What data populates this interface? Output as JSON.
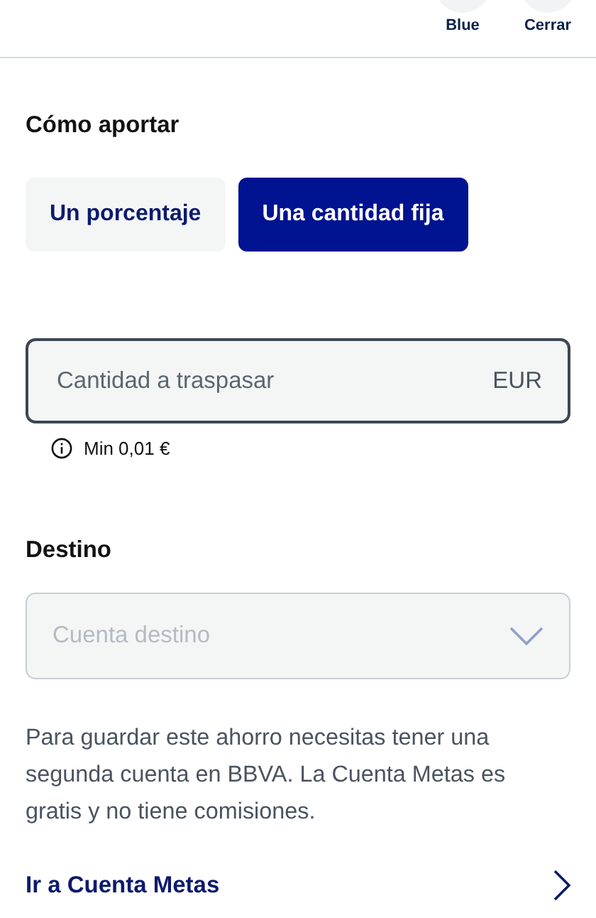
{
  "header_actions": [
    {
      "label": "Blue"
    },
    {
      "label": "Cerrar"
    }
  ],
  "section_title": "Cómo aportar",
  "options": [
    {
      "label": "Un porcentaje",
      "selected": false
    },
    {
      "label": "Una cantidad fija",
      "selected": true
    }
  ],
  "amount_field": {
    "placeholder": "Cantidad a traspasar",
    "currency": "EUR"
  },
  "hint": "Min 0,01 €",
  "destination_title": "Destino",
  "destination_select": {
    "placeholder": "Cuenta destino"
  },
  "info_text": "Para guardar este ahorro necesitas tener una segunda cuenta en BBVA. La Cuenta Metas es gratis y no tiene comisiones.",
  "link": "Ir a Cuenta Metas"
}
